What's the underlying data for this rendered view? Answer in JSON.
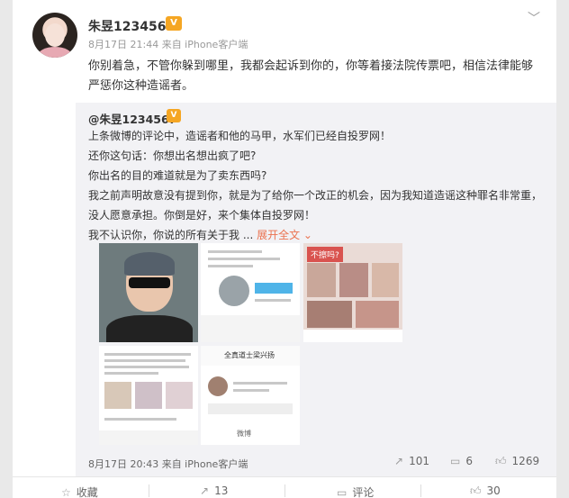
{
  "post": {
    "username": "朱昱1234567",
    "badge": "V",
    "meta": "8月17日 21:44 来自 iPhone客户端",
    "menu_icon": "chevron-down-icon",
    "text": "你别着急，不管你躲到哪里，我都会起诉到你的，你等着接法院传票吧，相信法律能够严惩你这种造谣者。"
  },
  "repost": {
    "username": "@朱昱1234567",
    "badge": "V",
    "lines": [
      "上条微博的评论中，造谣者和他的马甲，水军们已经自投罗网！",
      "还你这句话：你想出名想出疯了吧?",
      "你出名的目的难道就是为了卖东西吗?",
      "我之前声明故意没有提到你，就是为了给你一个改正的机会，因为我知道造谣这种罪名非常重，没人愿意承担。你倒是好，来个集体自投罗网！",
      "我不认识你，你说的所有关于我 ..."
    ],
    "expand_label": "展开全文",
    "expand_icon": "chevron-down-icon",
    "thumb3_label": "不擦吗?",
    "thumb5_title": "全真道士梁兴扬",
    "thumb5_tab": "微博",
    "time": "8月17日 20:43 来自 iPhone客户端",
    "stats": {
      "share": "101",
      "comment": "6",
      "like": "1269"
    }
  },
  "actions": {
    "favorite": "收藏",
    "share": "13",
    "comment": "评论",
    "like": "30"
  }
}
